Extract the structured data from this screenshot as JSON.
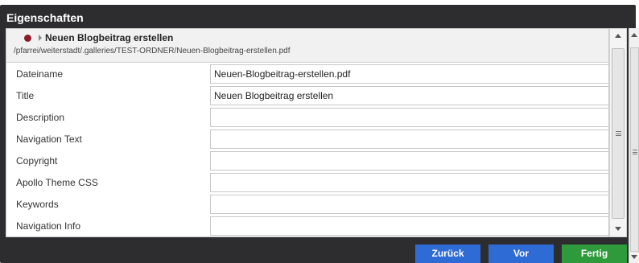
{
  "dialog": {
    "title": "Eigenschaften"
  },
  "resource": {
    "title": "Neuen Blogbeitrag erstellen",
    "path": "/pfarrei/weiterstadt/.galleries/TEST-ORDNER/Neuen-Blogbeitrag-erstellen.pdf",
    "status_color": "#8c1b2a"
  },
  "fields": [
    {
      "label": "Dateiname",
      "value": "Neuen-Blogbeitrag-erstellen.pdf"
    },
    {
      "label": "Title",
      "value": "Neuen Blogbeitrag erstellen"
    },
    {
      "label": "Description",
      "value": ""
    },
    {
      "label": "Navigation Text",
      "value": ""
    },
    {
      "label": "Copyright",
      "value": ""
    },
    {
      "label": "Apollo Theme CSS",
      "value": ""
    },
    {
      "label": "Keywords",
      "value": ""
    },
    {
      "label": "Navigation Info",
      "value": ""
    }
  ],
  "buttons": {
    "back": "Zurück",
    "next": "Vor",
    "done": "Fertig"
  },
  "colors": {
    "primary_button": "#2f6bd5",
    "success_button": "#2e9a3b",
    "titlebar": "#2d2d30"
  }
}
